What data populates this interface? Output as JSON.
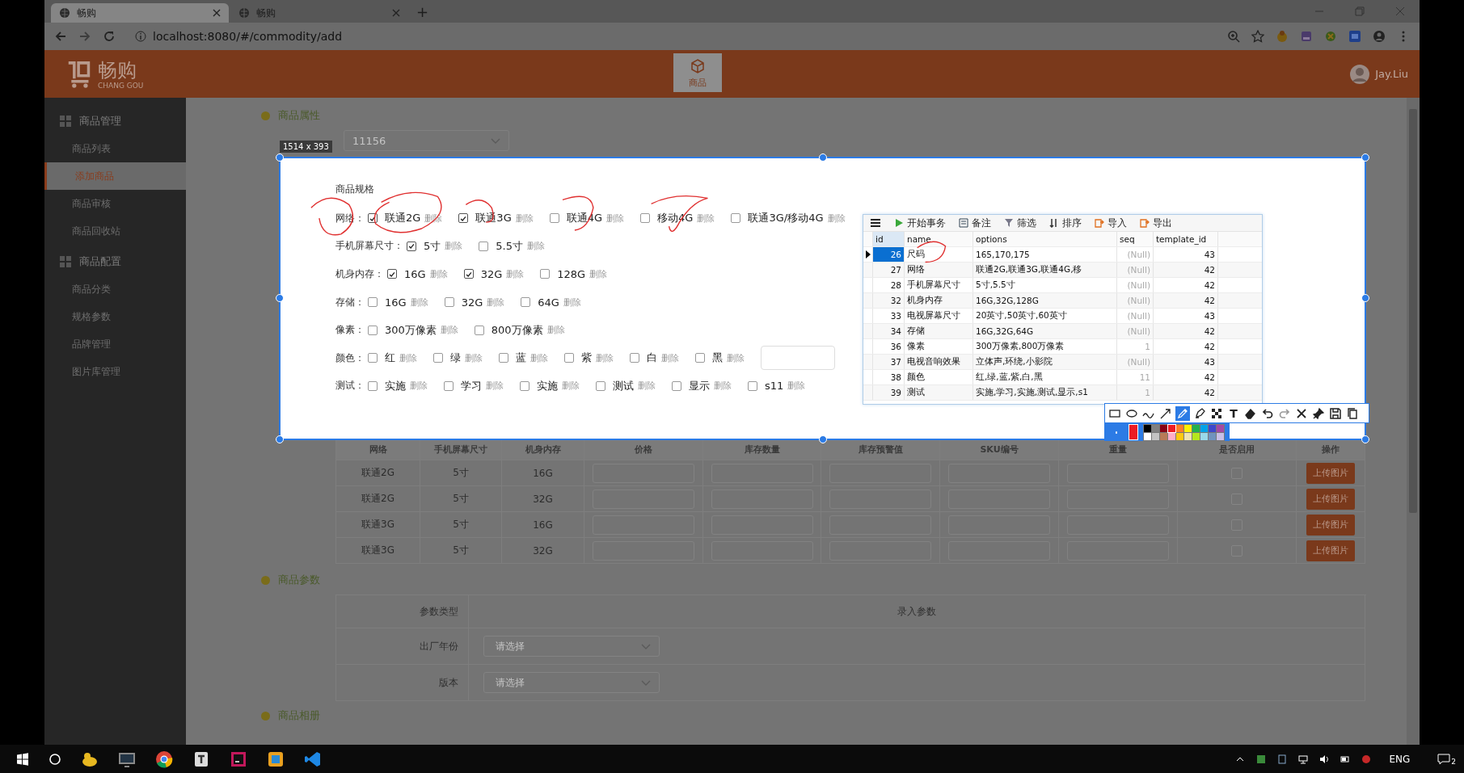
{
  "browser": {
    "tabs": [
      {
        "title": "畅购",
        "selected": true
      },
      {
        "title": "畅购",
        "selected": false
      }
    ],
    "new_tab": "+",
    "url": "localhost:8080/#/commodity/add"
  },
  "header": {
    "logo": "畅购",
    "logo_sub": "CHANG GOU",
    "nav": [
      {
        "label": "商品",
        "selected": true
      }
    ],
    "user": "Jay.Liu"
  },
  "sidebar": [
    {
      "title": "商品管理",
      "children": [
        {
          "label": "商品列表",
          "selected": false
        },
        {
          "label": "添加商品",
          "selected": true
        },
        {
          "label": "商品审核",
          "selected": false
        },
        {
          "label": "商品回收站",
          "selected": false
        }
      ]
    },
    {
      "title": "商品配置",
      "children": [
        {
          "label": "商品分类",
          "selected": false
        },
        {
          "label": "规格参数",
          "selected": false
        },
        {
          "label": "品牌管理",
          "selected": false
        },
        {
          "label": "图片库管理",
          "selected": false
        }
      ]
    }
  ],
  "attributes": {
    "title": "商品属性",
    "template_value": "11156"
  },
  "capture": {
    "size": "1514 x 393",
    "spec_title": "商品规格",
    "specs": [
      {
        "name": "网络：",
        "options": [
          {
            "label": "联通2G",
            "checked": true,
            "action": "删除"
          },
          {
            "label": "联通3G",
            "checked": true,
            "action": "删除"
          },
          {
            "label": "联通4G",
            "checked": false,
            "action": "删除"
          },
          {
            "label": "移动4G",
            "checked": false,
            "action": "删除"
          },
          {
            "label": "联通3G/移动4G",
            "checked": false,
            "action": "删除"
          }
        ]
      },
      {
        "name": "手机屏幕尺寸：",
        "options": [
          {
            "label": "5寸",
            "checked": true,
            "action": "删除"
          },
          {
            "label": "5.5寸",
            "checked": false,
            "action": "删除"
          }
        ]
      },
      {
        "name": "机身内存：",
        "options": [
          {
            "label": "16G",
            "checked": true,
            "action": "删除"
          },
          {
            "label": "32G",
            "checked": true,
            "action": "删除"
          },
          {
            "label": "128G",
            "checked": false,
            "action": "删除"
          }
        ]
      },
      {
        "name": "存储：",
        "options": [
          {
            "label": "16G",
            "checked": false,
            "action": "删除"
          },
          {
            "label": "32G",
            "checked": false,
            "action": "删除"
          },
          {
            "label": "64G",
            "checked": false,
            "action": "删除"
          }
        ]
      },
      {
        "name": "像素：",
        "options": [
          {
            "label": "300万像素",
            "checked": false,
            "action": "删除"
          },
          {
            "label": "800万像素",
            "checked": false,
            "action": "删除"
          }
        ]
      },
      {
        "name": "颜色：",
        "options": [
          {
            "label": "红",
            "checked": false,
            "action": "删除"
          },
          {
            "label": "绿",
            "checked": false,
            "action": "删除"
          },
          {
            "label": "蓝",
            "checked": false,
            "action": "删除"
          },
          {
            "label": "紫",
            "checked": false,
            "action": "删除"
          },
          {
            "label": "白",
            "checked": false,
            "action": "删除"
          },
          {
            "label": "黑",
            "checked": false,
            "action": "删除"
          }
        ],
        "has_input": true
      },
      {
        "name": "测试：",
        "options": [
          {
            "label": "实施",
            "checked": false,
            "action": "删除"
          },
          {
            "label": "学习",
            "checked": false,
            "action": "删除"
          },
          {
            "label": "实施",
            "checked": false,
            "action": "删除"
          },
          {
            "label": "测试",
            "checked": false,
            "action": "删除"
          },
          {
            "label": "显示",
            "checked": false,
            "action": "删除"
          },
          {
            "label": "s11",
            "checked": false,
            "action": "删除"
          }
        ]
      }
    ]
  },
  "db_grid": {
    "toolbar": [
      "开始事务",
      "备注",
      "筛选",
      "排序",
      "导入",
      "导出"
    ],
    "columns": [
      "id",
      "name",
      "options",
      "seq",
      "template_id"
    ],
    "rows": [
      {
        "cells": [
          "26",
          "尺码",
          "165,170,175",
          "(Null)",
          "43"
        ],
        "selected": true
      },
      {
        "cells": [
          "27",
          "网络",
          "联通2G,联通3G,联通4G,移",
          "(Null)",
          "42"
        ],
        "selected": false
      },
      {
        "cells": [
          "28",
          "手机屏幕尺寸",
          "5寸,5.5寸",
          "(Null)",
          "42"
        ],
        "selected": false
      },
      {
        "cells": [
          "32",
          "机身内存",
          "16G,32G,128G",
          "(Null)",
          "42"
        ],
        "selected": false
      },
      {
        "cells": [
          "33",
          "电视屏幕尺寸",
          "20英寸,50英寸,60英寸",
          "(Null)",
          "43"
        ],
        "selected": false
      },
      {
        "cells": [
          "34",
          "存储",
          "16G,32G,64G",
          "(Null)",
          "42"
        ],
        "selected": false
      },
      {
        "cells": [
          "36",
          "像素",
          "300万像素,800万像素",
          "1",
          "42"
        ],
        "selected": false
      },
      {
        "cells": [
          "37",
          "电视音响效果",
          "立体声,环绕,小影院",
          "(Null)",
          "43"
        ],
        "selected": false
      },
      {
        "cells": [
          "38",
          "颜色",
          "红,绿,蓝,紫,白,黑",
          "11",
          "42"
        ],
        "selected": false
      },
      {
        "cells": [
          "39",
          "测试",
          "实施,学习,实施,测试,显示,s1",
          "1",
          "42"
        ],
        "selected": false
      }
    ]
  },
  "sku_table": {
    "columns": [
      "网络",
      "手机屏幕尺寸",
      "机身内存",
      "价格",
      "库存数量",
      "库存预警值",
      "SKU编号",
      "重量",
      "是否启用",
      "操作"
    ],
    "rows": [
      {
        "cells": [
          "联通2G",
          "5寸",
          "16G"
        ],
        "enabled": false,
        "action": "上传图片"
      },
      {
        "cells": [
          "联通2G",
          "5寸",
          "32G"
        ],
        "enabled": false,
        "action": "上传图片"
      },
      {
        "cells": [
          "联通3G",
          "5寸",
          "16G"
        ],
        "enabled": false,
        "action": "上传图片"
      },
      {
        "cells": [
          "联通3G",
          "5寸",
          "32G"
        ],
        "enabled": false,
        "action": "上传图片"
      }
    ]
  },
  "params": {
    "title": "商品参数",
    "columns": [
      "参数类型",
      "录入参数"
    ],
    "rows": [
      {
        "label": "出厂年份",
        "placeholder": "请选择"
      },
      {
        "label": "版本",
        "placeholder": "请选择"
      }
    ]
  },
  "album": {
    "title": "商品相册"
  },
  "annotate": {
    "tools": [
      {
        "kind": "rect",
        "selected": false
      },
      {
        "kind": "ellipse",
        "selected": false
      },
      {
        "kind": "curve",
        "selected": false
      },
      {
        "kind": "arrow",
        "selected": false
      },
      {
        "kind": "pen",
        "selected": true
      },
      {
        "kind": "marker",
        "selected": false
      },
      {
        "kind": "mosaic",
        "selected": false
      },
      {
        "kind": "text",
        "selected": false
      },
      {
        "kind": "eraser",
        "selected": false
      },
      {
        "kind": "undo",
        "selected": false
      },
      {
        "kind": "redo",
        "selected": false
      },
      {
        "kind": "close",
        "selected": false
      },
      {
        "kind": "pin",
        "selected": false
      },
      {
        "kind": "save",
        "selected": false
      },
      {
        "kind": "copy",
        "selected": false
      }
    ],
    "text_glyph": "T",
    "palette": [
      {
        "color": "#000000",
        "selected": false
      },
      {
        "color": "#808080",
        "selected": false
      },
      {
        "color": "#880015",
        "selected": false
      },
      {
        "color": "#ed1c24",
        "selected": true
      },
      {
        "color": "#ff7f27",
        "selected": false
      },
      {
        "color": "#fff200",
        "selected": false
      },
      {
        "color": "#22b14c",
        "selected": false
      },
      {
        "color": "#00a2e8",
        "selected": false
      },
      {
        "color": "#3f48cc",
        "selected": false
      },
      {
        "color": "#a349a4",
        "selected": false
      },
      {
        "color": "#ffffff",
        "selected": false
      },
      {
        "color": "#c3c3c3",
        "selected": false
      },
      {
        "color": "#b97a57",
        "selected": false
      },
      {
        "color": "#ffaec9",
        "selected": false
      },
      {
        "color": "#ffc90e",
        "selected": false
      },
      {
        "color": "#efe4b0",
        "selected": false
      },
      {
        "color": "#b5e61d",
        "selected": false
      },
      {
        "color": "#99d9ea",
        "selected": false
      },
      {
        "color": "#7092be",
        "selected": false
      },
      {
        "color": "#c8bfe7",
        "selected": false
      }
    ]
  },
  "taskbar": {
    "lang": "ENG",
    "notifications": "2"
  }
}
